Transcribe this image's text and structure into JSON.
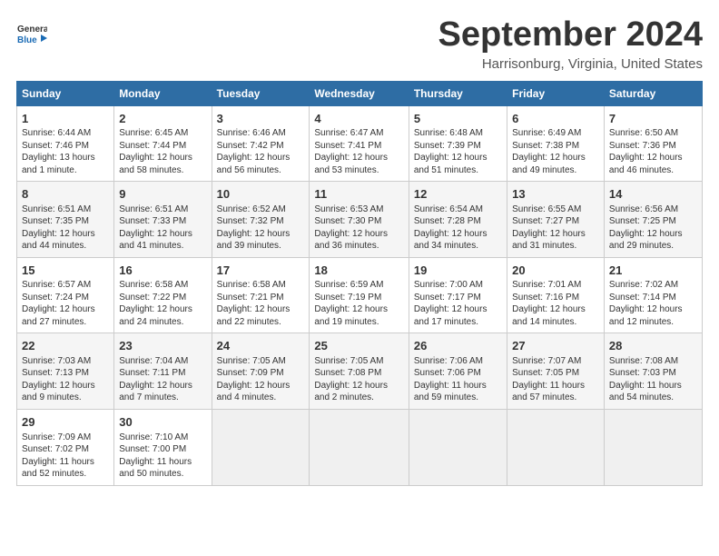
{
  "header": {
    "logo_line1": "General",
    "logo_line2": "Blue",
    "month_title": "September 2024",
    "location": "Harrisonburg, Virginia, United States"
  },
  "weekdays": [
    "Sunday",
    "Monday",
    "Tuesday",
    "Wednesday",
    "Thursday",
    "Friday",
    "Saturday"
  ],
  "weeks": [
    [
      {
        "day": "1",
        "info": "Sunrise: 6:44 AM\nSunset: 7:46 PM\nDaylight: 13 hours\nand 1 minute."
      },
      {
        "day": "2",
        "info": "Sunrise: 6:45 AM\nSunset: 7:44 PM\nDaylight: 12 hours\nand 58 minutes."
      },
      {
        "day": "3",
        "info": "Sunrise: 6:46 AM\nSunset: 7:42 PM\nDaylight: 12 hours\nand 56 minutes."
      },
      {
        "day": "4",
        "info": "Sunrise: 6:47 AM\nSunset: 7:41 PM\nDaylight: 12 hours\nand 53 minutes."
      },
      {
        "day": "5",
        "info": "Sunrise: 6:48 AM\nSunset: 7:39 PM\nDaylight: 12 hours\nand 51 minutes."
      },
      {
        "day": "6",
        "info": "Sunrise: 6:49 AM\nSunset: 7:38 PM\nDaylight: 12 hours\nand 49 minutes."
      },
      {
        "day": "7",
        "info": "Sunrise: 6:50 AM\nSunset: 7:36 PM\nDaylight: 12 hours\nand 46 minutes."
      }
    ],
    [
      {
        "day": "8",
        "info": "Sunrise: 6:51 AM\nSunset: 7:35 PM\nDaylight: 12 hours\nand 44 minutes."
      },
      {
        "day": "9",
        "info": "Sunrise: 6:51 AM\nSunset: 7:33 PM\nDaylight: 12 hours\nand 41 minutes."
      },
      {
        "day": "10",
        "info": "Sunrise: 6:52 AM\nSunset: 7:32 PM\nDaylight: 12 hours\nand 39 minutes."
      },
      {
        "day": "11",
        "info": "Sunrise: 6:53 AM\nSunset: 7:30 PM\nDaylight: 12 hours\nand 36 minutes."
      },
      {
        "day": "12",
        "info": "Sunrise: 6:54 AM\nSunset: 7:28 PM\nDaylight: 12 hours\nand 34 minutes."
      },
      {
        "day": "13",
        "info": "Sunrise: 6:55 AM\nSunset: 7:27 PM\nDaylight: 12 hours\nand 31 minutes."
      },
      {
        "day": "14",
        "info": "Sunrise: 6:56 AM\nSunset: 7:25 PM\nDaylight: 12 hours\nand 29 minutes."
      }
    ],
    [
      {
        "day": "15",
        "info": "Sunrise: 6:57 AM\nSunset: 7:24 PM\nDaylight: 12 hours\nand 27 minutes."
      },
      {
        "day": "16",
        "info": "Sunrise: 6:58 AM\nSunset: 7:22 PM\nDaylight: 12 hours\nand 24 minutes."
      },
      {
        "day": "17",
        "info": "Sunrise: 6:58 AM\nSunset: 7:21 PM\nDaylight: 12 hours\nand 22 minutes."
      },
      {
        "day": "18",
        "info": "Sunrise: 6:59 AM\nSunset: 7:19 PM\nDaylight: 12 hours\nand 19 minutes."
      },
      {
        "day": "19",
        "info": "Sunrise: 7:00 AM\nSunset: 7:17 PM\nDaylight: 12 hours\nand 17 minutes."
      },
      {
        "day": "20",
        "info": "Sunrise: 7:01 AM\nSunset: 7:16 PM\nDaylight: 12 hours\nand 14 minutes."
      },
      {
        "day": "21",
        "info": "Sunrise: 7:02 AM\nSunset: 7:14 PM\nDaylight: 12 hours\nand 12 minutes."
      }
    ],
    [
      {
        "day": "22",
        "info": "Sunrise: 7:03 AM\nSunset: 7:13 PM\nDaylight: 12 hours\nand 9 minutes."
      },
      {
        "day": "23",
        "info": "Sunrise: 7:04 AM\nSunset: 7:11 PM\nDaylight: 12 hours\nand 7 minutes."
      },
      {
        "day": "24",
        "info": "Sunrise: 7:05 AM\nSunset: 7:09 PM\nDaylight: 12 hours\nand 4 minutes."
      },
      {
        "day": "25",
        "info": "Sunrise: 7:05 AM\nSunset: 7:08 PM\nDaylight: 12 hours\nand 2 minutes."
      },
      {
        "day": "26",
        "info": "Sunrise: 7:06 AM\nSunset: 7:06 PM\nDaylight: 11 hours\nand 59 minutes."
      },
      {
        "day": "27",
        "info": "Sunrise: 7:07 AM\nSunset: 7:05 PM\nDaylight: 11 hours\nand 57 minutes."
      },
      {
        "day": "28",
        "info": "Sunrise: 7:08 AM\nSunset: 7:03 PM\nDaylight: 11 hours\nand 54 minutes."
      }
    ],
    [
      {
        "day": "29",
        "info": "Sunrise: 7:09 AM\nSunset: 7:02 PM\nDaylight: 11 hours\nand 52 minutes."
      },
      {
        "day": "30",
        "info": "Sunrise: 7:10 AM\nSunset: 7:00 PM\nDaylight: 11 hours\nand 50 minutes."
      },
      {
        "day": "",
        "info": ""
      },
      {
        "day": "",
        "info": ""
      },
      {
        "day": "",
        "info": ""
      },
      {
        "day": "",
        "info": ""
      },
      {
        "day": "",
        "info": ""
      }
    ]
  ]
}
